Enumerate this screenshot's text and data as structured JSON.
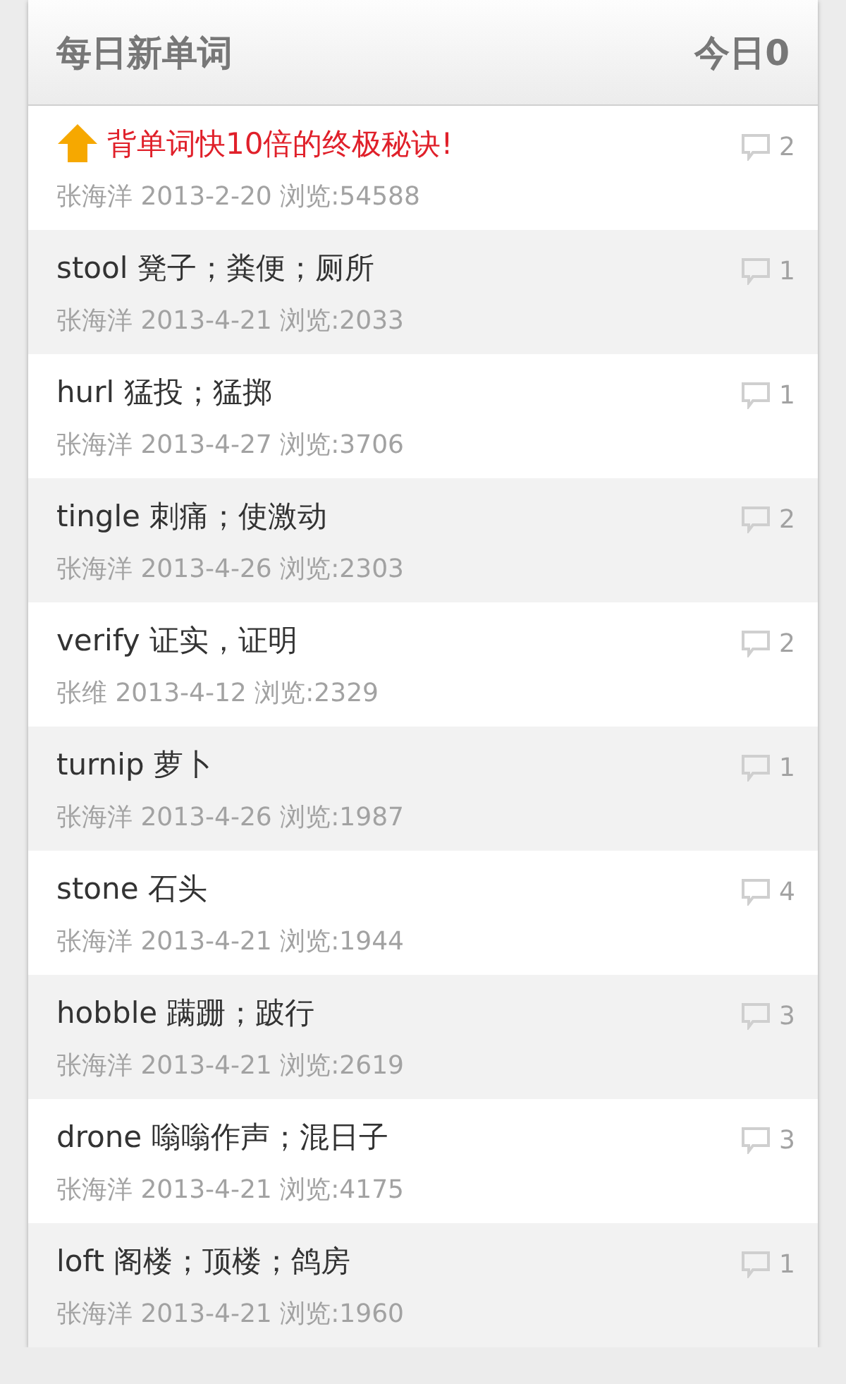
{
  "header": {
    "title": "每日新单词",
    "today": "今日0"
  },
  "items": [
    {
      "kind": "pinned",
      "title": "背单词快10倍的终极秘诀!",
      "meta": "张海洋 2013-2-20 浏览:54588",
      "comments": "2"
    },
    {
      "kind": "word",
      "title": "stool 凳子；粪便；厕所",
      "meta": "张海洋 2013-4-21 浏览:2033",
      "comments": "1"
    },
    {
      "kind": "word",
      "title": "hurl 猛投；猛掷",
      "meta": "张海洋 2013-4-27 浏览:3706",
      "comments": "1"
    },
    {
      "kind": "word",
      "title": "tingle 刺痛；使激动",
      "meta": "张海洋 2013-4-26 浏览:2303",
      "comments": "2"
    },
    {
      "kind": "word",
      "title": "verify 证实，证明",
      "meta": "张维 2013-4-12 浏览:2329",
      "comments": "2"
    },
    {
      "kind": "word",
      "title": "turnip 萝卜",
      "meta": "张海洋 2013-4-26 浏览:1987",
      "comments": "1"
    },
    {
      "kind": "word",
      "title": "stone 石头",
      "meta": "张海洋 2013-4-21 浏览:1944",
      "comments": "4"
    },
    {
      "kind": "word",
      "title": "hobble 蹒跚；跛行",
      "meta": "张海洋 2013-4-21 浏览:2619",
      "comments": "3"
    },
    {
      "kind": "word",
      "title": "drone 嗡嗡作声；混日子",
      "meta": "张海洋 2013-4-21 浏览:4175",
      "comments": "3"
    },
    {
      "kind": "word",
      "title": "loft 阁楼；顶楼；鸽房",
      "meta": "张海洋 2013-4-21 浏览:1960",
      "comments": "1"
    }
  ]
}
